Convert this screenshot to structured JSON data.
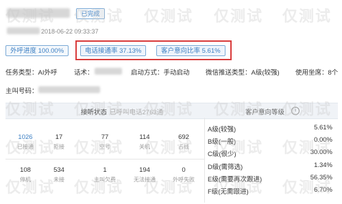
{
  "status": "已完成",
  "timestamp": "2018-06-22 09:33:37",
  "metrics": {
    "outbound_progress": "外呼进度 100.00%",
    "connect_rate": "电话接通率 37.13%",
    "intent_rate": "客户意向比率 5.61%"
  },
  "info": {
    "task_type": "任务类型：AI外呼",
    "script": "话术：",
    "start_mode": "启动方式：手动启动",
    "wechat_type": "微信推送类型：A级(较强)",
    "seats": "使用坐席：8个"
  },
  "caller_label": "主叫号码：",
  "panel": {
    "connect_status": "接听状态",
    "connect_status_sub": "已呼叫电话2763通",
    "intent_level": "客户意向等级",
    "info_icon": "i"
  },
  "stats_row1": [
    {
      "value": "1026",
      "label": "已接通",
      "link": true
    },
    {
      "value": "17",
      "label": "拒接",
      "link": false
    },
    {
      "value": "77",
      "label": "空号",
      "link": false
    },
    {
      "value": "114",
      "label": "关机",
      "link": false
    },
    {
      "value": "692",
      "label": "占线",
      "link": false
    }
  ],
  "stats_row2": [
    {
      "value": "108",
      "label": "停机",
      "link": false
    },
    {
      "value": "534",
      "label": "未接",
      "link": false
    },
    {
      "value": "1",
      "label": "主叫欠费",
      "link": false
    },
    {
      "value": "194",
      "label": "无法接通",
      "link": false
    },
    {
      "value": "0",
      "label": "外呼失败",
      "link": false
    }
  ],
  "grades": [
    {
      "name": "A级(较强)",
      "value": "5.61%"
    },
    {
      "name": "B级(一般)",
      "value": "0.00%"
    },
    {
      "name": "C级(很少)",
      "value": "30.00%"
    },
    {
      "name": "D级(需筛选)",
      "value": "1.34%"
    },
    {
      "name": "E级(需要再次跟进)",
      "value": "56.35%"
    },
    {
      "name": "F级(无需跟进)",
      "value": "6.70%"
    }
  ],
  "watermark": "仅测试"
}
